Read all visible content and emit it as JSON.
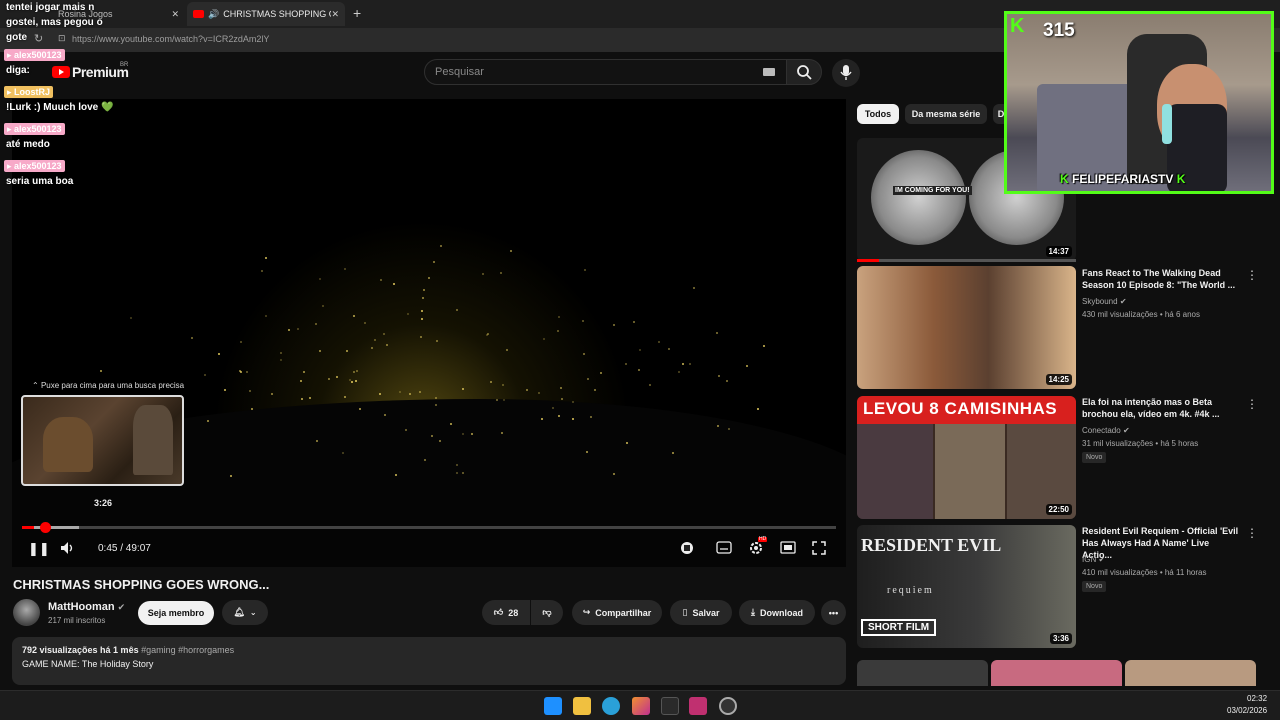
{
  "browser": {
    "tab1_label": "Rosina Jogos",
    "tab2_label": "CHRISTMAS SHOPPING GOES",
    "url": "https://www.youtube.com/watch?v=ICR2zdAm2lY"
  },
  "youtube_header": {
    "logo_text": "Premium",
    "region": "BR",
    "search_placeholder": "Pesquisar"
  },
  "player": {
    "preview_hint": "Puxe para cima para uma busca precisa",
    "preview_time": "3:26",
    "current_time": "0:45 / 49:07",
    "progress_fraction": 0.0153,
    "hover_fraction": 0.07
  },
  "video": {
    "title": "CHRISTMAS SHOPPING GOES WRONG...",
    "channel": "MattHooman",
    "subscribers": "217 mil inscritos",
    "member_button": "Seja membro",
    "likes": "28",
    "share_label": "Compartilhar",
    "save_label": "Salvar",
    "download_label": "Download",
    "views_date": "792 visualizações  há 1 mês",
    "hashtags": "#gaming #horrorgames",
    "description": "GAME NAME: The Holiday Story"
  },
  "sidebar": {
    "chips": [
      "Todos",
      "Da mesma série",
      "D"
    ],
    "recommendations": [
      {
        "title": "",
        "channel": "",
        "meta": "",
        "duration": "14:37",
        "thumb_text": "IM COMING FOR YOU!",
        "is_new": false
      },
      {
        "title": "Fans React to The Walking Dead Season 10 Episode 8: \"The World ...",
        "channel": "Skybound",
        "meta": "430 mil visualizações • há 6 anos",
        "duration": "14:25",
        "thumb_text": "",
        "is_new": false
      },
      {
        "title": "Ela foi na intenção mas o Beta brochou ela, vídeo em 4k. #4k ...",
        "channel": "Conectado",
        "meta": "31 mil visualizações • há 5 horas",
        "duration": "22:50",
        "thumb_text": "LEVOU 8 CAMISINHAS",
        "is_new": true
      },
      {
        "title": "Resident Evil Requiem - Official 'Evil Has Always Had A Name' Live Actio...",
        "channel": "IGN",
        "meta": "410 mil visualizações • há 11 horas",
        "duration": "3:36",
        "thumb_text": "RESIDENT EVIL",
        "thumb_sub": "requiem",
        "thumb_badge": "SHORT FILM",
        "is_new": true
      }
    ],
    "new_label": "Novo"
  },
  "chat": [
    {
      "type": "msg",
      "text": "tentei jogar mais n gostei, mas pegou o gote"
    },
    {
      "type": "name",
      "text": "alex500123",
      "color": "#f7a9c8"
    },
    {
      "type": "msg",
      "text": "diga:"
    },
    {
      "type": "name",
      "text": "LoostRJ",
      "color": "#f0c060"
    },
    {
      "type": "msg",
      "text": "!Lurk :) Muuch love 💚"
    },
    {
      "type": "name",
      "text": "alex500123",
      "color": "#f7a9c8"
    },
    {
      "type": "msg",
      "text": "até medo"
    },
    {
      "type": "name",
      "text": "alex500123",
      "color": "#f7a9c8"
    },
    {
      "type": "msg",
      "text": "seria uma boa"
    }
  ],
  "stream": {
    "kick_logo": "K",
    "viewers": "315",
    "streamer": "FELIPEFARIASTV",
    "accent": "#53fc18"
  },
  "taskbar": {
    "time": "02:32",
    "date": "03/02/2026"
  }
}
